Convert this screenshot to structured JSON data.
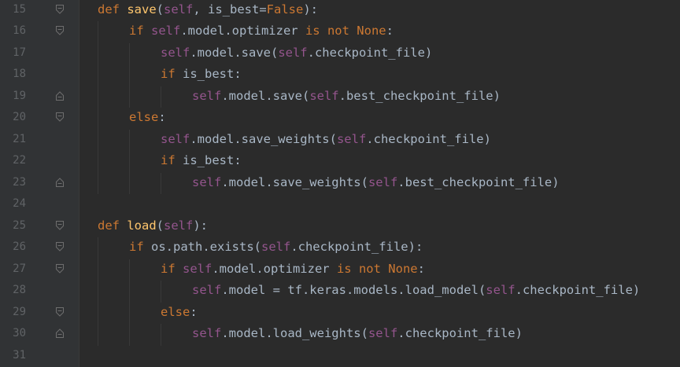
{
  "lines": [
    {
      "number": "15",
      "fold": "open",
      "indent": 0,
      "tokens": [
        {
          "t": "def ",
          "c": "kw"
        },
        {
          "t": "save",
          "c": "fn"
        },
        {
          "t": "(",
          "c": "plain"
        },
        {
          "t": "self",
          "c": "self"
        },
        {
          "t": ", is_best=",
          "c": "plain"
        },
        {
          "t": "False",
          "c": "kw"
        },
        {
          "t": "):",
          "c": "plain"
        }
      ]
    },
    {
      "number": "16",
      "fold": "open",
      "indent": 1,
      "tokens": [
        {
          "t": "if ",
          "c": "kw"
        },
        {
          "t": "self",
          "c": "self"
        },
        {
          "t": ".model.optimizer ",
          "c": "plain"
        },
        {
          "t": "is not ",
          "c": "kw"
        },
        {
          "t": "None",
          "c": "kw"
        },
        {
          "t": ":",
          "c": "plain"
        }
      ]
    },
    {
      "number": "17",
      "fold": "none",
      "indent": 2,
      "tokens": [
        {
          "t": "self",
          "c": "self"
        },
        {
          "t": ".model.save(",
          "c": "plain"
        },
        {
          "t": "self",
          "c": "self"
        },
        {
          "t": ".checkpoint_file)",
          "c": "plain"
        }
      ]
    },
    {
      "number": "18",
      "fold": "none",
      "indent": 2,
      "tokens": [
        {
          "t": "if ",
          "c": "kw"
        },
        {
          "t": "is_best:",
          "c": "plain"
        }
      ]
    },
    {
      "number": "19",
      "fold": "close",
      "indent": 3,
      "tokens": [
        {
          "t": "self",
          "c": "self"
        },
        {
          "t": ".model.save(",
          "c": "plain"
        },
        {
          "t": "self",
          "c": "self"
        },
        {
          "t": ".best_checkpoint_file)",
          "c": "plain"
        }
      ]
    },
    {
      "number": "20",
      "fold": "open",
      "indent": 1,
      "tokens": [
        {
          "t": "else",
          "c": "kw"
        },
        {
          "t": ":",
          "c": "plain"
        }
      ]
    },
    {
      "number": "21",
      "fold": "none",
      "indent": 2,
      "tokens": [
        {
          "t": "self",
          "c": "self"
        },
        {
          "t": ".model.save_weights(",
          "c": "plain"
        },
        {
          "t": "self",
          "c": "self"
        },
        {
          "t": ".checkpoint_file)",
          "c": "plain"
        }
      ]
    },
    {
      "number": "22",
      "fold": "none",
      "indent": 2,
      "tokens": [
        {
          "t": "if ",
          "c": "kw"
        },
        {
          "t": "is_best:",
          "c": "plain"
        }
      ]
    },
    {
      "number": "23",
      "fold": "close",
      "indent": 3,
      "tokens": [
        {
          "t": "self",
          "c": "self"
        },
        {
          "t": ".model.save_weights(",
          "c": "plain"
        },
        {
          "t": "self",
          "c": "self"
        },
        {
          "t": ".best_checkpoint_file)",
          "c": "plain"
        }
      ]
    },
    {
      "number": "24",
      "fold": "none",
      "indent": 0,
      "tokens": []
    },
    {
      "number": "25",
      "fold": "open",
      "indent": 0,
      "tokens": [
        {
          "t": "def ",
          "c": "kw"
        },
        {
          "t": "load",
          "c": "fn"
        },
        {
          "t": "(",
          "c": "plain"
        },
        {
          "t": "self",
          "c": "self"
        },
        {
          "t": "):",
          "c": "plain"
        }
      ]
    },
    {
      "number": "26",
      "fold": "open",
      "indent": 1,
      "tokens": [
        {
          "t": "if ",
          "c": "kw"
        },
        {
          "t": "os.path.exists(",
          "c": "plain"
        },
        {
          "t": "self",
          "c": "self"
        },
        {
          "t": ".checkpoint_file):",
          "c": "plain"
        }
      ]
    },
    {
      "number": "27",
      "fold": "open",
      "indent": 2,
      "tokens": [
        {
          "t": "if ",
          "c": "kw"
        },
        {
          "t": "self",
          "c": "self"
        },
        {
          "t": ".model.optimizer ",
          "c": "plain"
        },
        {
          "t": "is not ",
          "c": "kw"
        },
        {
          "t": "None",
          "c": "kw"
        },
        {
          "t": ":",
          "c": "plain"
        }
      ]
    },
    {
      "number": "28",
      "fold": "none",
      "indent": 3,
      "tokens": [
        {
          "t": "self",
          "c": "self"
        },
        {
          "t": ".model = tf.keras.models.load_model(",
          "c": "plain"
        },
        {
          "t": "self",
          "c": "self"
        },
        {
          "t": ".checkpoint_file)",
          "c": "plain"
        }
      ]
    },
    {
      "number": "29",
      "fold": "open",
      "indent": 2,
      "tokens": [
        {
          "t": "else",
          "c": "kw"
        },
        {
          "t": ":",
          "c": "plain"
        }
      ]
    },
    {
      "number": "30",
      "fold": "close",
      "indent": 3,
      "tokens": [
        {
          "t": "self",
          "c": "self"
        },
        {
          "t": ".model.load_weights(",
          "c": "plain"
        },
        {
          "t": "self",
          "c": "self"
        },
        {
          "t": ".checkpoint_file)",
          "c": "plain"
        }
      ]
    },
    {
      "number": "31",
      "fold": "none",
      "indent": 0,
      "tokens": []
    }
  ],
  "colors": {
    "background": "#2b2b2b",
    "gutter": "#313335",
    "line_number": "#606366",
    "keyword": "#cc7832",
    "self": "#94558d",
    "function": "#ffc66d",
    "plain": "#a9b7c6",
    "fold_icon": "#6e6e6e"
  },
  "icons": {
    "fold_open": "fold-open-icon",
    "fold_close": "fold-close-icon"
  }
}
